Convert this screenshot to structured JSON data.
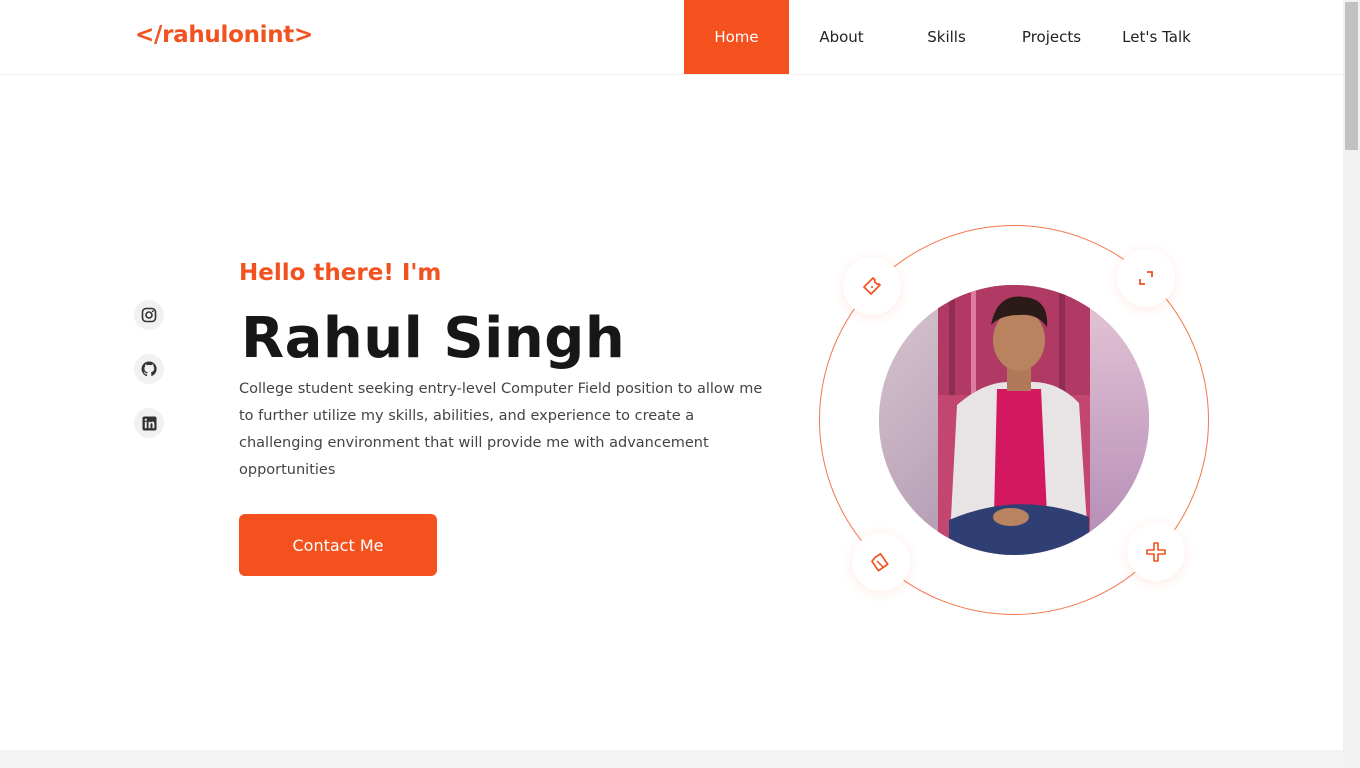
{
  "header": {
    "logo": "</rahulonint>",
    "nav": [
      {
        "label": "Home",
        "active": true
      },
      {
        "label": "About",
        "active": false
      },
      {
        "label": "Skills",
        "active": false
      },
      {
        "label": "Projects",
        "active": false
      },
      {
        "label": "Let's Talk",
        "active": false
      }
    ]
  },
  "social": [
    {
      "icon": "instagram-icon"
    },
    {
      "icon": "github-icon"
    },
    {
      "icon": "linkedin-icon"
    }
  ],
  "hero": {
    "greeting": "Hello there! I'm",
    "name": "Rahul Singh",
    "description": "College student seeking entry-level Computer Field position to allow me to further utilize my skills, abilities, and experience to create a challenging environment that will provide me with advancement opportunities",
    "cta_label": "Contact Me"
  },
  "orbit_icons": [
    "ticket-icon",
    "expand-icon",
    "ruler-icon",
    "crosshair-icon"
  ],
  "colors": {
    "accent": "#f4511e",
    "text": "#171717",
    "muted": "#444444"
  }
}
